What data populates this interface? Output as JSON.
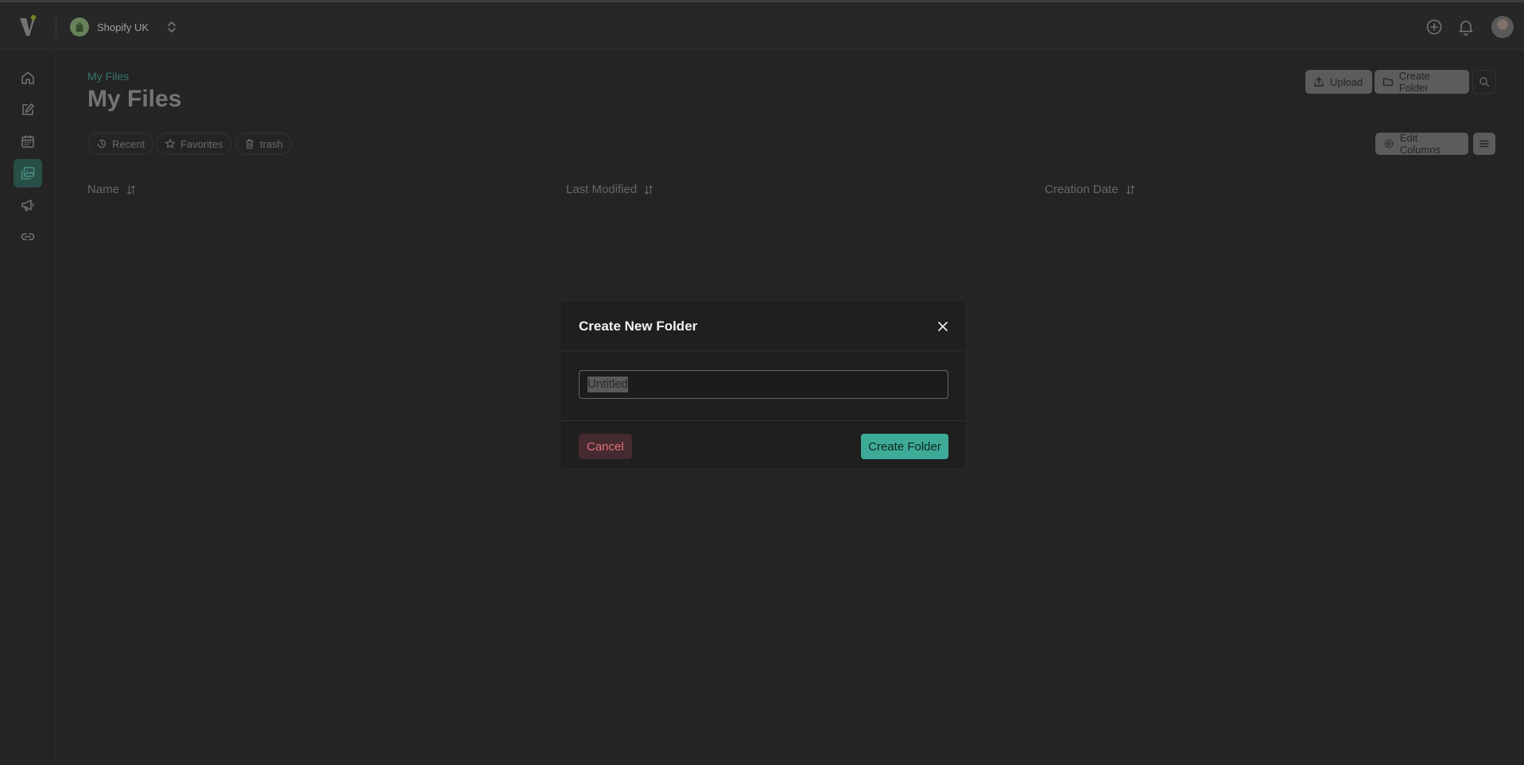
{
  "app": {
    "store_name": "Shopify UK"
  },
  "sidebar": {
    "items": [
      {
        "name": "home",
        "icon": "home-icon",
        "active": false
      },
      {
        "name": "compose",
        "icon": "edit-icon",
        "active": false
      },
      {
        "name": "calendar",
        "icon": "calendar-icon",
        "active": false
      },
      {
        "name": "media-library",
        "icon": "images-icon",
        "active": true
      },
      {
        "name": "campaigns",
        "icon": "megaphone-icon",
        "active": false
      },
      {
        "name": "links",
        "icon": "link-icon",
        "active": false
      }
    ]
  },
  "page": {
    "breadcrumb": "My Files",
    "title": "My Files",
    "upload_label": "Upload",
    "create_folder_label": "Create Folder",
    "edit_columns_label": "Edit Columns"
  },
  "filters": {
    "recent": "Recent",
    "favorites": "Favorites",
    "trash": "trash"
  },
  "table": {
    "columns": [
      "Name",
      "Last Modified",
      "Creation Date"
    ]
  },
  "modal": {
    "title": "Create New Folder",
    "input_value": "Untitled",
    "cancel_label": "Cancel",
    "submit_label": "Create Folder"
  },
  "colors": {
    "accent": "#3dab97",
    "active_nav": "#2f5d55",
    "danger_text": "#e0707a",
    "background": "#2b2b2b"
  }
}
